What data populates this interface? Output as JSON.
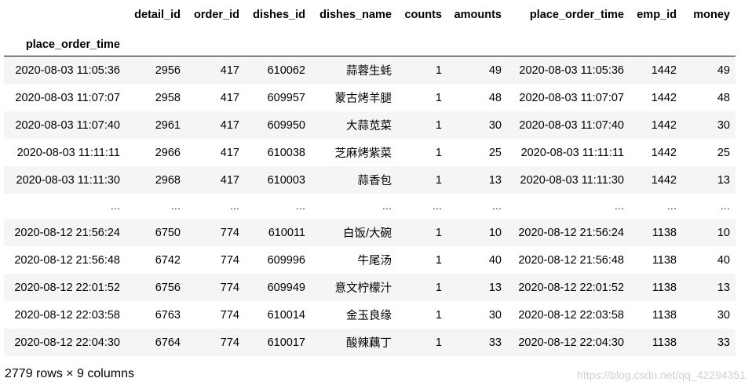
{
  "table": {
    "columns": [
      "detail_id",
      "order_id",
      "dishes_id",
      "dishes_name",
      "counts",
      "amounts",
      "place_order_time",
      "emp_id",
      "money"
    ],
    "index_name": "place_order_time",
    "rows": [
      [
        "2020-08-03 11:05:36",
        "2956",
        "417",
        "610062",
        "蒜蓉生蚝",
        "1",
        "49",
        "2020-08-03 11:05:36",
        "1442",
        "49"
      ],
      [
        "2020-08-03 11:07:07",
        "2958",
        "417",
        "609957",
        "蒙古烤羊腿",
        "1",
        "48",
        "2020-08-03 11:07:07",
        "1442",
        "48"
      ],
      [
        "2020-08-03 11:07:40",
        "2961",
        "417",
        "609950",
        "大蒜苋菜",
        "1",
        "30",
        "2020-08-03 11:07:40",
        "1442",
        "30"
      ],
      [
        "2020-08-03 11:11:11",
        "2966",
        "417",
        "610038",
        "芝麻烤紫菜",
        "1",
        "25",
        "2020-08-03 11:11:11",
        "1442",
        "25"
      ],
      [
        "2020-08-03 11:11:30",
        "2968",
        "417",
        "610003",
        "蒜香包",
        "1",
        "13",
        "2020-08-03 11:11:30",
        "1442",
        "13"
      ],
      [
        "...",
        "...",
        "...",
        "...",
        "...",
        "...",
        "...",
        "...",
        "...",
        "..."
      ],
      [
        "2020-08-12 21:56:24",
        "6750",
        "774",
        "610011",
        "白饭/大碗",
        "1",
        "10",
        "2020-08-12 21:56:24",
        "1138",
        "10"
      ],
      [
        "2020-08-12 21:56:48",
        "6742",
        "774",
        "609996",
        "牛尾汤",
        "1",
        "40",
        "2020-08-12 21:56:48",
        "1138",
        "40"
      ],
      [
        "2020-08-12 22:01:52",
        "6756",
        "774",
        "609949",
        "意文柠檬汁",
        "1",
        "13",
        "2020-08-12 22:01:52",
        "1138",
        "13"
      ],
      [
        "2020-08-12 22:03:58",
        "6763",
        "774",
        "610014",
        "金玉良缘",
        "1",
        "30",
        "2020-08-12 22:03:58",
        "1138",
        "30"
      ],
      [
        "2020-08-12 22:04:30",
        "6764",
        "774",
        "610017",
        "酸辣藕丁",
        "1",
        "33",
        "2020-08-12 22:04:30",
        "1138",
        "33"
      ]
    ]
  },
  "footer": {
    "shape_text": "2779 rows × 9 columns"
  },
  "watermark": {
    "text": "https://blog.csdn.net/qq_42294351"
  },
  "colors": {
    "stripe": "#f5f5f5",
    "header_rule": "#000000",
    "watermark": "#d0d0d0"
  }
}
